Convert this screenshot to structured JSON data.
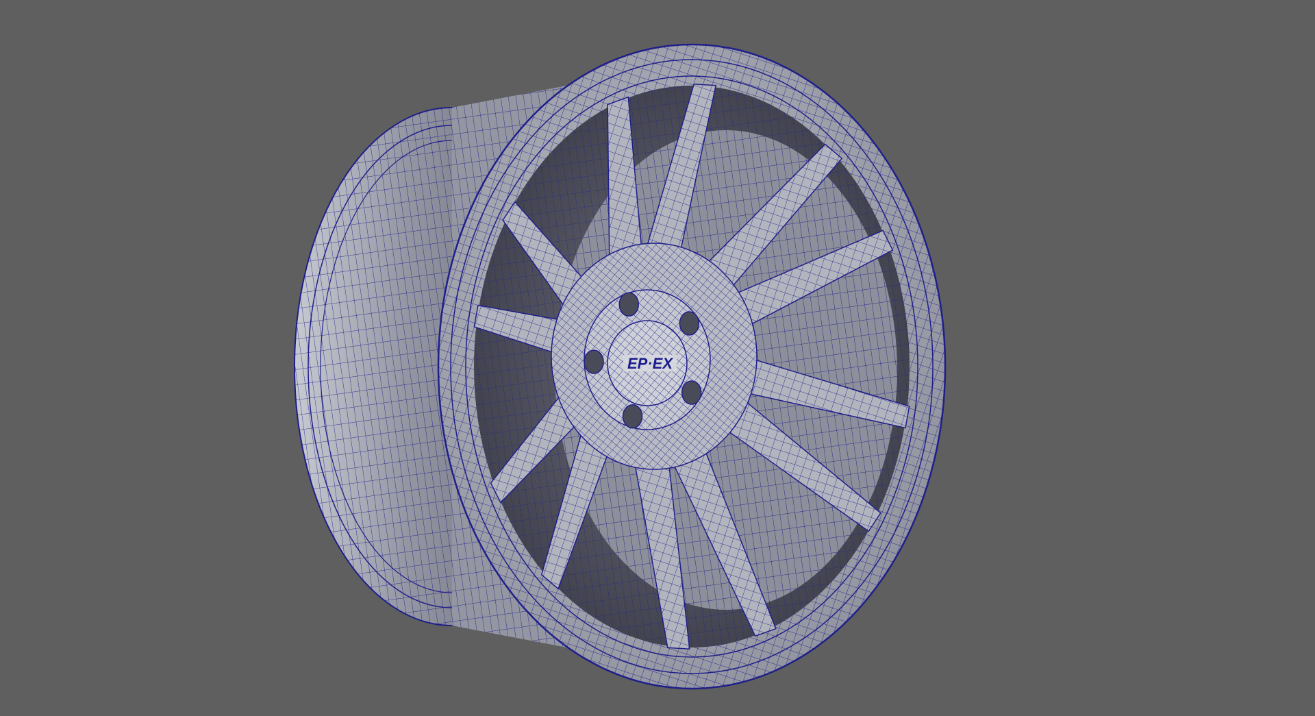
{
  "viewport": {
    "background_color": "#5f5f5f",
    "mesh_color": "#1f1f8a",
    "surface_color": "#a9abb4"
  },
  "model": {
    "object": "wheel-rim-wireframe",
    "spoke_count": 12,
    "lug_hole_count": 5,
    "center_logo_text": "EP·EX"
  }
}
